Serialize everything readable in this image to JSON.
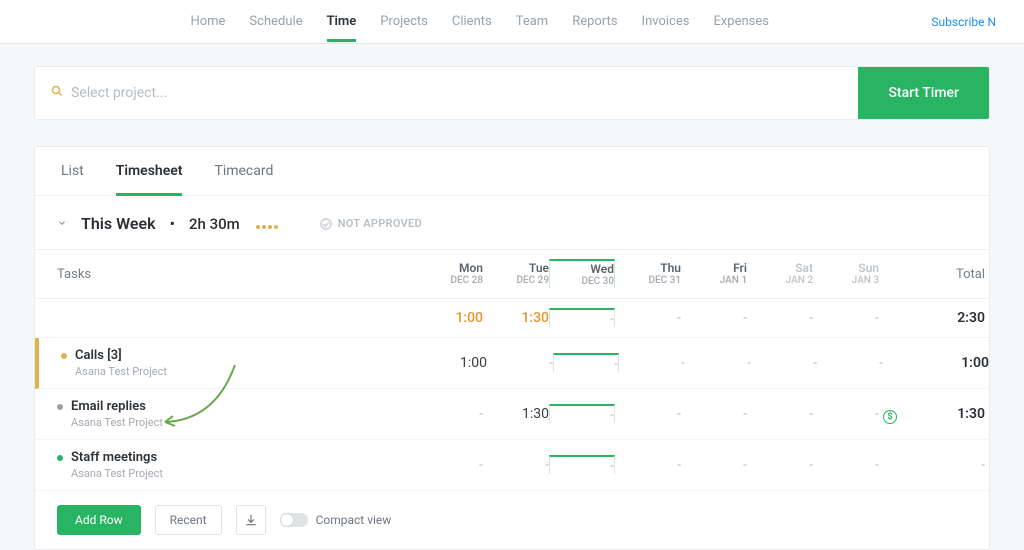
{
  "nav": {
    "items": [
      "Home",
      "Schedule",
      "Time",
      "Projects",
      "Clients",
      "Team",
      "Reports",
      "Invoices",
      "Expenses"
    ],
    "active": "Time",
    "subscribe": "Subscribe N"
  },
  "timer": {
    "placeholder": "Select project...",
    "start": "Start Timer"
  },
  "tabs": [
    "List",
    "Timesheet",
    "Timecard"
  ],
  "active_tab": "Timesheet",
  "summary": {
    "title": "This Week",
    "bullet": "•",
    "total": "2h 30m",
    "status": "NOT APPROVED"
  },
  "head": {
    "tasks": "Tasks",
    "days": [
      {
        "d": "Mon",
        "s": "DEC 28"
      },
      {
        "d": "Tue",
        "s": "DEC 29"
      },
      {
        "d": "Wed",
        "s": "DEC 30"
      },
      {
        "d": "Thu",
        "s": "DEC 31"
      },
      {
        "d": "Fri",
        "s": "JAN 1"
      },
      {
        "d": "Sat",
        "s": "JAN 2"
      },
      {
        "d": "Sun",
        "s": "JAN 3"
      }
    ],
    "total": "Total"
  },
  "rows": [
    {
      "title": "",
      "sub": "",
      "dot": "",
      "cells": [
        "1:00",
        "1:30",
        "-",
        "-",
        "-",
        "-",
        "-"
      ],
      "total": "2:30",
      "money": false,
      "orange": true
    },
    {
      "title": "Calls [3]",
      "sub": "Asana Test Project",
      "dot": "#e0b24d",
      "cells": [
        "1:00",
        "-",
        "-",
        "-",
        "-",
        "-",
        "-"
      ],
      "total": "1:00",
      "money": false,
      "orange": false
    },
    {
      "title": "Email replies",
      "sub": "Asana Test Project",
      "dot": "#9aa1a9",
      "cells": [
        "-",
        "1:30",
        "-",
        "-",
        "-",
        "-",
        "-"
      ],
      "total": "1:30",
      "money": true,
      "orange": false
    },
    {
      "title": "Staff meetings",
      "sub": "Asana Test Project",
      "dot": "#28b463",
      "cells": [
        "-",
        "-",
        "-",
        "-",
        "-",
        "-",
        "-"
      ],
      "total": "-",
      "money": false,
      "orange": false
    }
  ],
  "footer": {
    "add": "Add Row",
    "recent": "Recent",
    "compact": "Compact view"
  },
  "dash": "-"
}
